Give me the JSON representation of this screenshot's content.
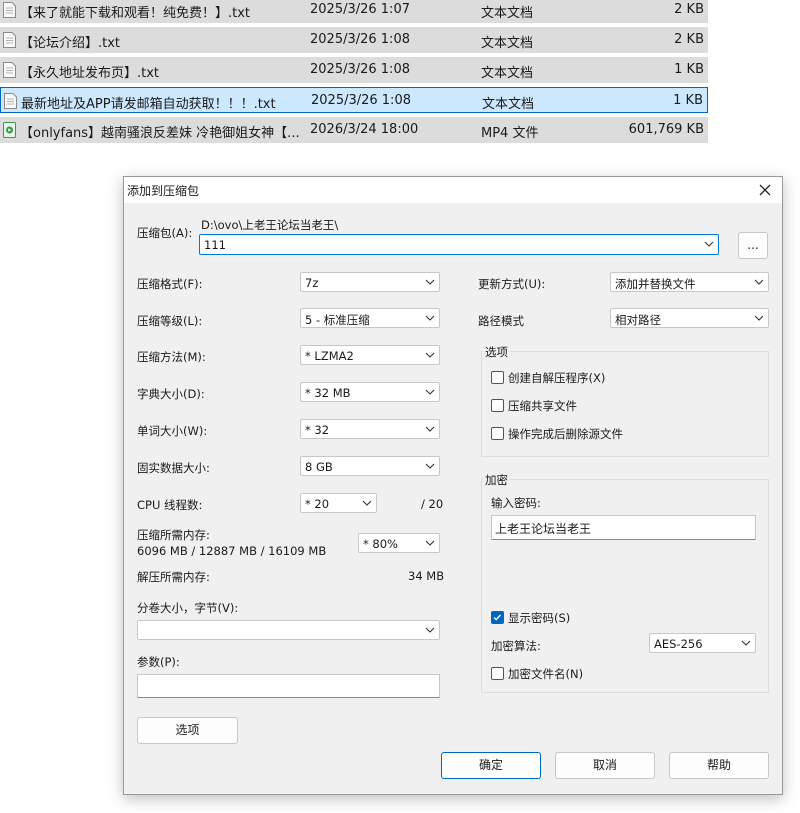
{
  "files": [
    {
      "name": "【来了就能下载和观看！纯免费！】.txt",
      "date": "2025/3/26 1:07",
      "type": "文本文档",
      "size": "2 KB",
      "icon": "text-file-icon",
      "selected": false
    },
    {
      "name": "【论坛介绍】.txt",
      "date": "2025/3/26 1:08",
      "type": "文本文档",
      "size": "2 KB",
      "icon": "text-file-icon",
      "selected": false
    },
    {
      "name": "【永久地址发布页】.txt",
      "date": "2025/3/26 1:08",
      "type": "文本文档",
      "size": "1 KB",
      "icon": "text-file-icon",
      "selected": false
    },
    {
      "name": "最新地址及APP请发邮箱自动获取！！！.txt",
      "date": "2025/3/26 1:08",
      "type": "文本文档",
      "size": "1 KB",
      "icon": "text-file-icon",
      "selected": true
    },
    {
      "name": "【onlyfans】越南骚浪反差妹 冷艳御姐女神【...",
      "date": "2026/3/24 18:00",
      "type": "MP4 文件",
      "size": "601,769 KB",
      "icon": "video-file-icon",
      "selected": false
    }
  ],
  "dialog": {
    "title": "添加到压缩包",
    "archive_label": "压缩包(A):",
    "archive_path": "D:\\ovo\\上老王论坛当老王\\",
    "archive_name": "111",
    "browse_label": "...",
    "format_label": "压缩格式(F):",
    "format_value": "7z",
    "level_label": "压缩等级(L):",
    "level_value": "5 - 标准压缩",
    "method_label": "压缩方法(M):",
    "method_value": "*  LZMA2",
    "dict_label": "字典大小(D):",
    "dict_value": "*  32 MB",
    "word_label": "单词大小(W):",
    "word_value": "*  32",
    "solid_label": "固实数据大小:",
    "solid_value": "8 GB",
    "cpu_label": "CPU 线程数:",
    "cpu_value": "*  20",
    "cpu_total": "/ 20",
    "mem_label": "压缩所需内存:",
    "mem_detail": "6096 MB / 12887 MB / 16109 MB",
    "mem_value": "*  80%",
    "decomp_label": "解压所需内存:",
    "decomp_value": "34 MB",
    "split_label": "分卷大小，字节(V):",
    "split_value": "",
    "params_label": "参数(P):",
    "params_value": "",
    "options_button": "选项",
    "update_label": "更新方式(U):",
    "update_value": "添加并替换文件",
    "path_label": "路径模式",
    "path_value": "相对路径",
    "options_group": "选项",
    "opt_sfx": "创建自解压程序(X)",
    "opt_shared": "压缩共享文件",
    "opt_delete": "操作完成后删除源文件",
    "encrypt_group": "加密",
    "password_label": "输入密码:",
    "password_value": "上老王论坛当老王",
    "show_password": "显示密码(S)",
    "show_password_checked": true,
    "enc_method_label": "加密算法:",
    "enc_method_value": "AES-256",
    "enc_filenames": "加密文件名(N)",
    "ok": "确定",
    "cancel": "取消",
    "help": "帮助"
  }
}
